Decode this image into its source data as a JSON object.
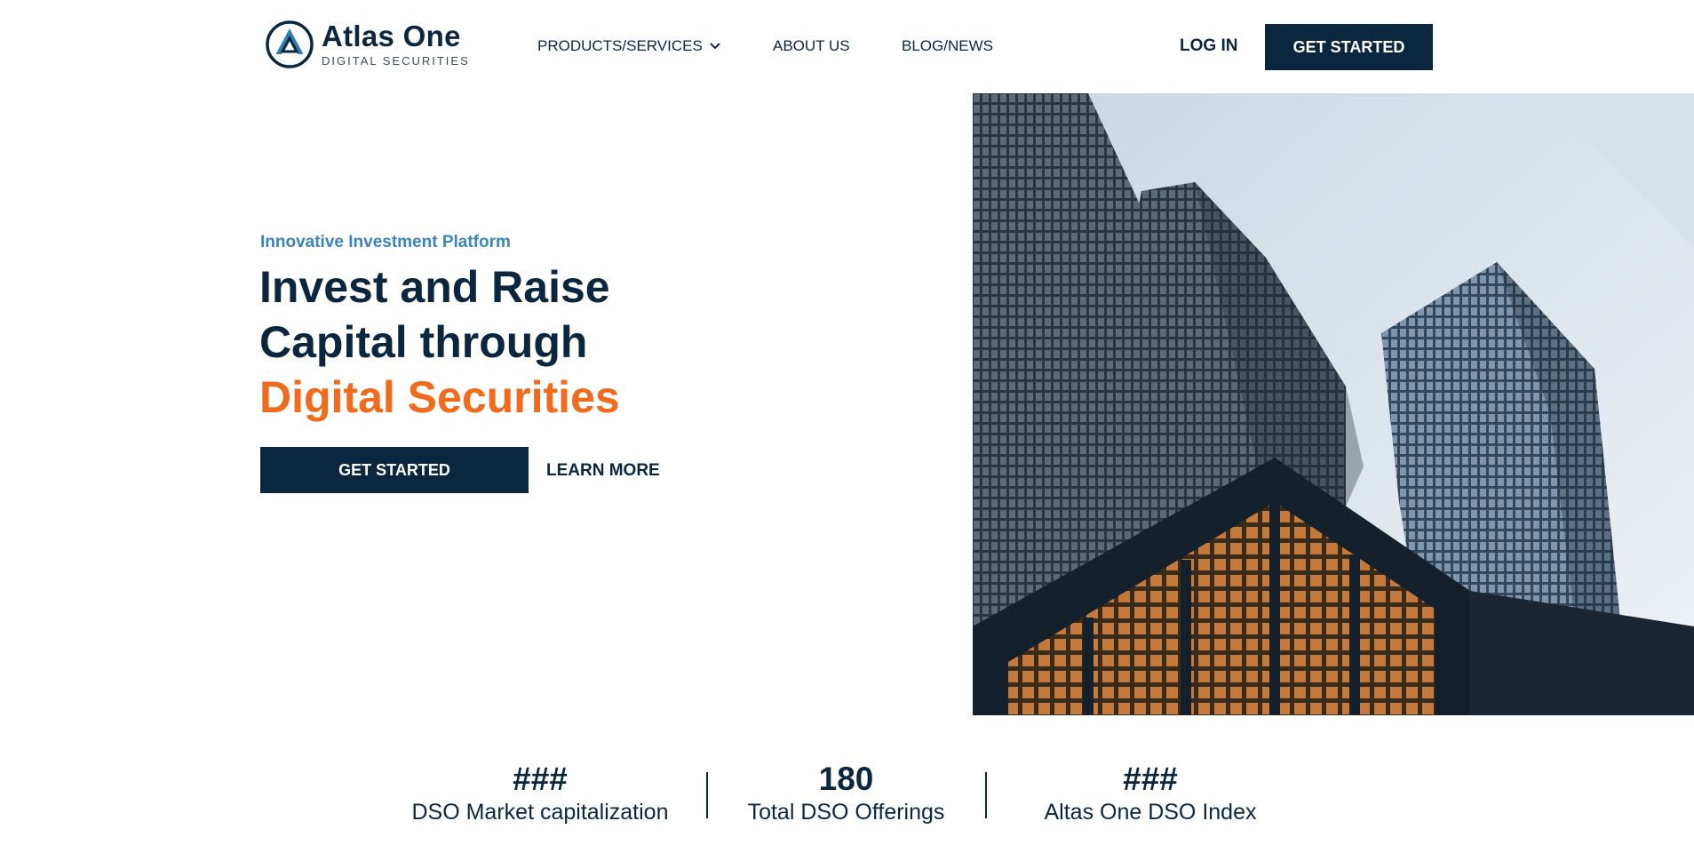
{
  "brand": {
    "name": "Atlas One",
    "tagline": "DIGITAL SECURITIES",
    "colors": {
      "navy": "#0b2740",
      "orange": "#f26a1b",
      "blue": "#3a86b8"
    }
  },
  "nav": {
    "items": [
      {
        "label": "PRODUCTS/SERVICES",
        "icon": "chevron-down-icon"
      },
      {
        "label": "ABOUT US"
      },
      {
        "label": "BLOG/NEWS"
      }
    ],
    "login_label": "LOG IN",
    "cta_label": "GET STARTED"
  },
  "hero": {
    "eyebrow": "Innovative Investment Platform",
    "headline_line1": "Invest and Raise",
    "headline_line2": "Capital through",
    "headline_accent": "Digital Securities",
    "primary_cta": "GET STARTED",
    "secondary_cta": "LEARN MORE"
  },
  "stats": [
    {
      "value": "###",
      "label": "DSO Market capitalization"
    },
    {
      "value": "180",
      "label": "Total DSO Offerings"
    },
    {
      "value": "###",
      "label": "Altas One DSO Index"
    }
  ]
}
